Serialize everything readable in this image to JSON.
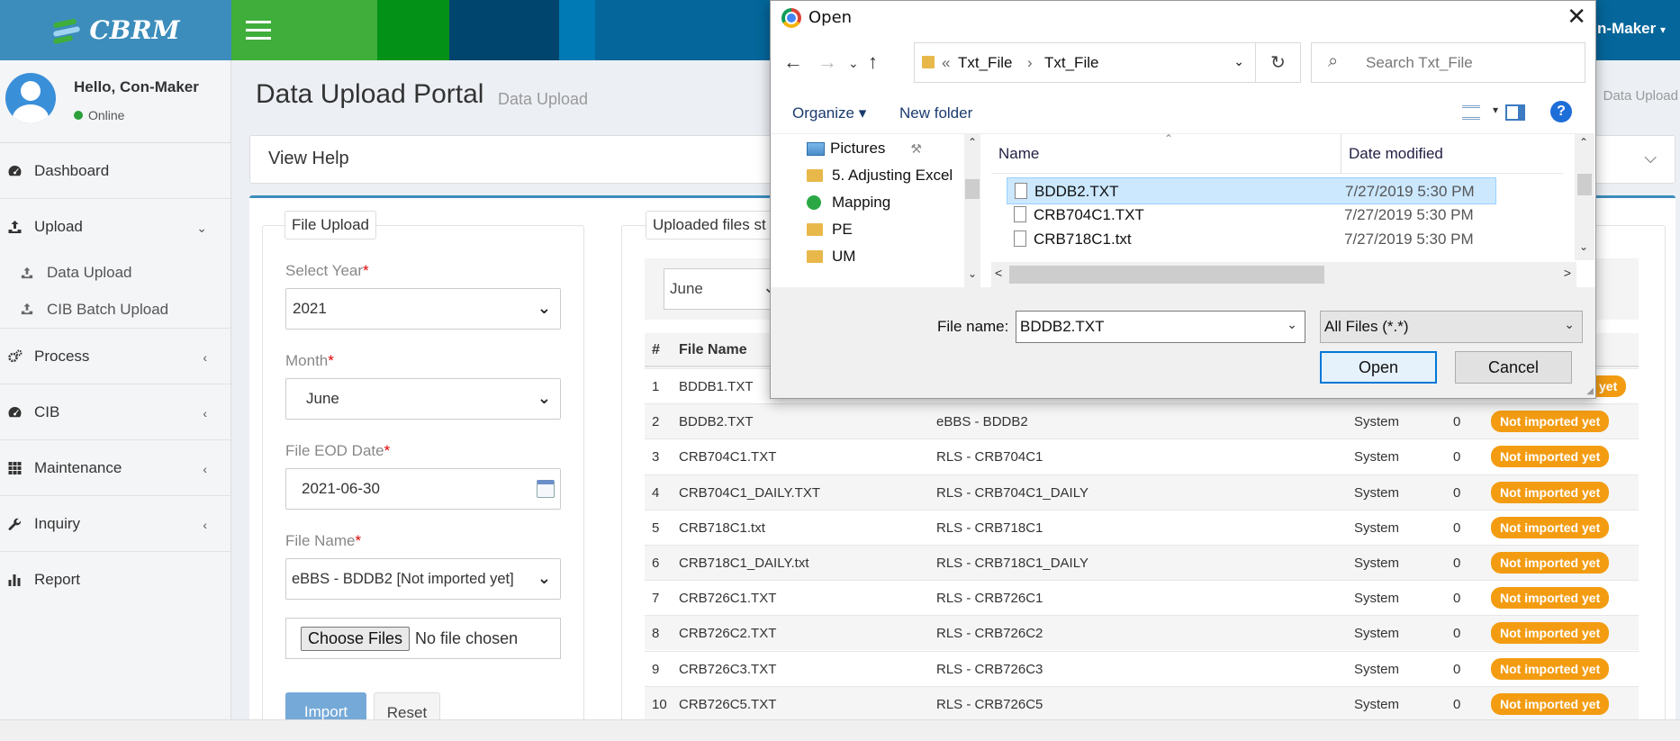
{
  "header": {
    "brand": "CBRM",
    "user_menu": "n-Maker",
    "segment_colors": [
      "#039118",
      "#00456d",
      "#007ab5"
    ]
  },
  "sidebar": {
    "greeting": "Hello, Con-Maker",
    "status": "Online",
    "items": [
      {
        "label": "Dashboard",
        "icon": "dashboard-icon",
        "chevron": ""
      },
      {
        "label": "Upload",
        "icon": "upload-icon",
        "chevron": "⌄"
      },
      {
        "label": "Process",
        "icon": "gears-icon",
        "chevron": "‹"
      },
      {
        "label": "CIB",
        "icon": "dashboard-icon",
        "chevron": "‹"
      },
      {
        "label": "Maintenance",
        "icon": "grid-icon",
        "chevron": "‹"
      },
      {
        "label": "Inquiry",
        "icon": "wrench-icon",
        "chevron": "‹"
      },
      {
        "label": "Report",
        "icon": "bar-chart-icon",
        "chevron": ""
      }
    ],
    "upload_sub": [
      "Data Upload",
      "CIB Batch Upload"
    ]
  },
  "page": {
    "title": "Data Upload Portal",
    "subtitle": "Data Upload",
    "breadcrumb": "Data Upload",
    "help_title": "View Help"
  },
  "upload_form": {
    "legend": "File Upload",
    "year_label": "Select Year",
    "year_value": "2021",
    "month_label": "Month",
    "month_value": "June",
    "eod_label": "File EOD Date",
    "eod_value": "2021-06-30",
    "filename_label": "File Name",
    "filename_value": "eBBS - BDDB2 [Not imported yet]",
    "choose_label": "Choose Files",
    "no_file": "No file chosen",
    "import_label": "Import",
    "reset_label": "Reset",
    "required_mark": "*"
  },
  "files_panel": {
    "legend": "Uploaded files st",
    "filter_month": "June",
    "columns": {
      "num": "#",
      "name": "File Name"
    },
    "rows": [
      {
        "n": "1",
        "file": "BDDB1.TXT",
        "desc": "",
        "by": "",
        "count": "",
        "status": "yet"
      },
      {
        "n": "2",
        "file": "BDDB2.TXT",
        "desc": "eBBS - BDDB2",
        "by": "System",
        "count": "0",
        "status": "Not imported yet"
      },
      {
        "n": "3",
        "file": "CRB704C1.TXT",
        "desc": "RLS - CRB704C1",
        "by": "System",
        "count": "0",
        "status": "Not imported yet"
      },
      {
        "n": "4",
        "file": "CRB704C1_DAILY.TXT",
        "desc": "RLS - CRB704C1_DAILY",
        "by": "System",
        "count": "0",
        "status": "Not imported yet"
      },
      {
        "n": "5",
        "file": "CRB718C1.txt",
        "desc": "RLS - CRB718C1",
        "by": "System",
        "count": "0",
        "status": "Not imported yet"
      },
      {
        "n": "6",
        "file": "CRB718C1_DAILY.txt",
        "desc": "RLS - CRB718C1_DAILY",
        "by": "System",
        "count": "0",
        "status": "Not imported yet"
      },
      {
        "n": "7",
        "file": "CRB726C1.TXT",
        "desc": "RLS - CRB726C1",
        "by": "System",
        "count": "0",
        "status": "Not imported yet"
      },
      {
        "n": "8",
        "file": "CRB726C2.TXT",
        "desc": "RLS - CRB726C2",
        "by": "System",
        "count": "0",
        "status": "Not imported yet"
      },
      {
        "n": "9",
        "file": "CRB726C3.TXT",
        "desc": "RLS - CRB726C3",
        "by": "System",
        "count": "0",
        "status": "Not imported yet"
      },
      {
        "n": "10",
        "file": "CRB726C5.TXT",
        "desc": "RLS - CRB726C5",
        "by": "System",
        "count": "0",
        "status": "Not imported yet"
      }
    ]
  },
  "dialog": {
    "title": "Open",
    "address": [
      "«",
      "Txt_File",
      "›",
      "Txt_File"
    ],
    "search_placeholder": "Search Txt_File",
    "organize": "Organize ▾",
    "new_folder": "New folder",
    "tree": [
      {
        "label": "Pictures",
        "icon": "pictures-icon"
      },
      {
        "label": "5. Adjusting Excel",
        "icon": "folder-icon"
      },
      {
        "label": "Mapping",
        "icon": "sync-folder-icon"
      },
      {
        "label": "PE",
        "icon": "folder-icon"
      },
      {
        "label": "UM",
        "icon": "folder-icon"
      }
    ],
    "col_name": "Name",
    "col_date": "Date modified",
    "files": [
      {
        "name": "BDDB2.TXT",
        "date": "7/27/2019 5:30 PM",
        "selected": true
      },
      {
        "name": "CRB704C1.TXT",
        "date": "7/27/2019 5:30 PM",
        "selected": false
      },
      {
        "name": "CRB718C1.txt",
        "date": "7/27/2019 5:30 PM",
        "selected": false
      }
    ],
    "filename_label": "File name:",
    "filename_value": "BDDB2.TXT",
    "filetype": "All Files (*.*)",
    "open_label": "Open",
    "cancel_label": "Cancel",
    "help_glyph": "?"
  }
}
